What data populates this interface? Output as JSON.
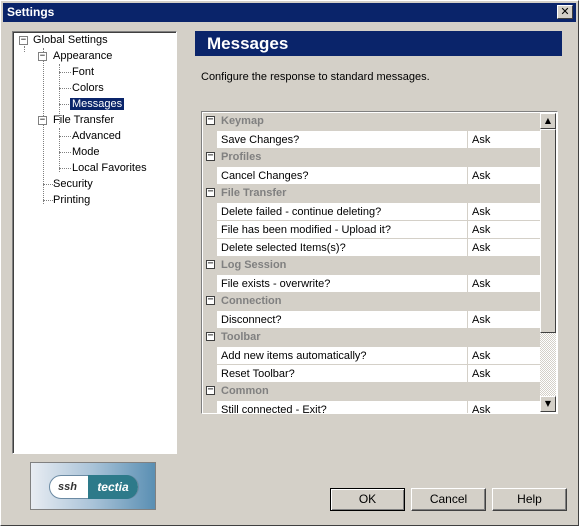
{
  "window": {
    "title": "Settings",
    "close_glyph": "✕"
  },
  "tree": {
    "items": [
      {
        "label": "Global Settings",
        "expander": "−"
      },
      {
        "label": "Appearance",
        "expander": "−"
      },
      {
        "label": "Font"
      },
      {
        "label": "Colors"
      },
      {
        "label": "Messages",
        "selected": true
      },
      {
        "label": "File Transfer",
        "expander": "−"
      },
      {
        "label": "Advanced"
      },
      {
        "label": "Mode"
      },
      {
        "label": "Local Favorites"
      },
      {
        "label": "Security"
      },
      {
        "label": "Printing"
      }
    ]
  },
  "logo": {
    "ssh": "ssh",
    "tectia": "tectia"
  },
  "panel": {
    "title": "Messages",
    "description": "Configure the response to standard messages."
  },
  "grid": {
    "rows": [
      {
        "type": "category",
        "label": "Keymap",
        "expander": "−"
      },
      {
        "type": "item",
        "name": "Save Changes?",
        "value": "Ask"
      },
      {
        "type": "category",
        "label": "Profiles",
        "expander": "−"
      },
      {
        "type": "item",
        "name": "Cancel Changes?",
        "value": "Ask"
      },
      {
        "type": "category",
        "label": "File Transfer",
        "expander": "−"
      },
      {
        "type": "item",
        "name": "Delete failed - continue deleting?",
        "value": "Ask"
      },
      {
        "type": "item",
        "name": "File has been modified - Upload it?",
        "value": "Ask"
      },
      {
        "type": "item",
        "name": "Delete selected Items(s)?",
        "value": "Ask"
      },
      {
        "type": "category",
        "label": "Log Session",
        "expander": "−"
      },
      {
        "type": "item",
        "name": "File exists - overwrite?",
        "value": "Ask"
      },
      {
        "type": "category",
        "label": "Connection",
        "expander": "−"
      },
      {
        "type": "item",
        "name": "Disconnect?",
        "value": "Ask"
      },
      {
        "type": "category",
        "label": "Toolbar",
        "expander": "−"
      },
      {
        "type": "item",
        "name": "Add new items automatically?",
        "value": "Ask"
      },
      {
        "type": "item",
        "name": "Reset Toolbar?",
        "value": "Ask"
      },
      {
        "type": "category",
        "label": "Common",
        "expander": "−"
      },
      {
        "type": "item",
        "name": "Still connected - Exit?",
        "value": "Ask"
      }
    ],
    "scroll_up_glyph": "▲",
    "scroll_down_glyph": "▼"
  },
  "buttons": {
    "ok": "OK",
    "cancel": "Cancel",
    "help": "Help"
  }
}
